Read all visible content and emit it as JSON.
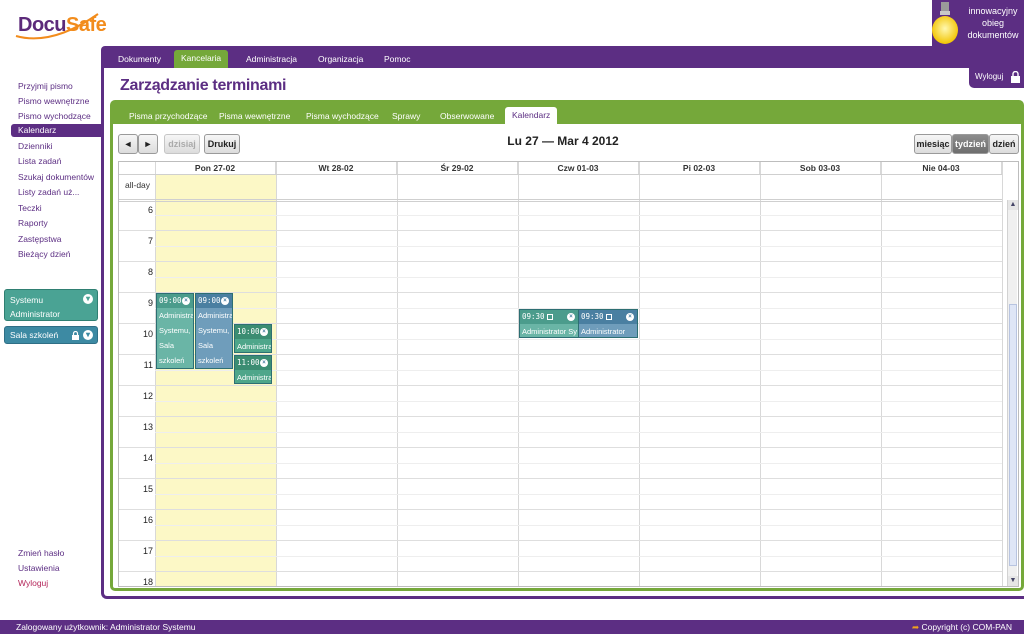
{
  "brand": {
    "logo_part1": "Docu",
    "logo_part2": "Safe",
    "tagline_lines": [
      "innowacyjny",
      "obieg",
      "dokumentów"
    ]
  },
  "top_tabs": [
    {
      "label": "Dokumenty",
      "active": false
    },
    {
      "label": "Kancelaria",
      "active": true
    },
    {
      "label": "Administracja",
      "active": false
    },
    {
      "label": "Organizacja",
      "active": false
    },
    {
      "label": "Pomoc",
      "active": false
    }
  ],
  "sidebar": {
    "items": [
      {
        "label": "Przyjmij pismo",
        "active": false
      },
      {
        "label": "Pismo wewnętrzne",
        "active": false
      },
      {
        "label": "Pismo wychodzące",
        "active": false
      },
      {
        "label": "Kalendarz",
        "active": true
      },
      {
        "label": "Dzienniki",
        "active": false
      },
      {
        "label": "Lista zadań",
        "active": false
      },
      {
        "label": "Szukaj dokumentów",
        "active": false
      },
      {
        "label": "Listy zadań uż...",
        "active": false
      },
      {
        "label": "Teczki",
        "active": false
      },
      {
        "label": "Raporty",
        "active": false
      },
      {
        "label": "Zastępstwa",
        "active": false
      },
      {
        "label": "Bieżący dzień",
        "active": false
      }
    ],
    "user_box": {
      "line1": "Systemu",
      "line2": "Administrator"
    },
    "room_box": {
      "label": "Sala szkoleń"
    },
    "bottom_links": [
      {
        "label": "Zmień hasło",
        "color": "#5c2e83"
      },
      {
        "label": "Ustawienia",
        "color": "#5c2e83"
      },
      {
        "label": "Wyloguj",
        "color": "#b4265a"
      }
    ]
  },
  "page": {
    "title": "Zarządzanie terminami",
    "logout_label": "Wyloguj"
  },
  "sub_tabs": [
    {
      "label": "Pisma przychodzące",
      "active": false
    },
    {
      "label": "Pisma wewnętrzne",
      "active": false
    },
    {
      "label": "Pisma wychodzące",
      "active": false
    },
    {
      "label": "Sprawy",
      "active": false
    },
    {
      "label": "Obserwowane",
      "active": false
    },
    {
      "label": "Kalendarz",
      "active": true
    }
  ],
  "calendar": {
    "prev_label": "◄",
    "next_label": "►",
    "today_label": "dzisiaj",
    "print_label": "Drukuj",
    "range_title": "Lu 27 — Mar 4 2012",
    "views": [
      {
        "label": "miesiąc",
        "active": false
      },
      {
        "label": "tydzień",
        "active": true
      },
      {
        "label": "dzień",
        "active": false
      }
    ],
    "allday_label": "all-day",
    "days": [
      "Pon 27-02",
      "Wt 28-02",
      "Śr 29-02",
      "Czw 01-03",
      "Pi 02-03",
      "Sob 03-03",
      "Nie 04-03"
    ],
    "hours": [
      "6",
      "7",
      "8",
      "9",
      "10",
      "11",
      "12",
      "13",
      "14",
      "15",
      "16",
      "17",
      "18"
    ],
    "events": [
      {
        "day": 0,
        "start": 9.0,
        "end": 11.5,
        "lane": 0,
        "lanes": 3,
        "time": "09:00",
        "lines": [
          "Administra",
          "Systemu,",
          "Sala",
          "szkoleń"
        ],
        "style": "teal",
        "icon": "close"
      },
      {
        "day": 0,
        "start": 9.0,
        "end": 11.5,
        "lane": 1,
        "lanes": 3,
        "time": "09:00",
        "lines": [
          "Administra",
          "Systemu,",
          "Sala",
          "szkoleń"
        ],
        "style": "blue",
        "icon": "close"
      },
      {
        "day": 0,
        "start": 10.0,
        "end": 11.0,
        "lane": 2,
        "lanes": 3,
        "time": "10:00",
        "lines": [
          "Administra"
        ],
        "style": "green",
        "icon": "close"
      },
      {
        "day": 0,
        "start": 11.0,
        "end": 12.0,
        "lane": 2,
        "lanes": 3,
        "time": "11:00",
        "lines": [
          "Administra"
        ],
        "style": "green",
        "icon": "close"
      },
      {
        "day": 3,
        "start": 9.5,
        "end": 10.5,
        "lane": 0,
        "lanes": 2,
        "time": "09:30",
        "lines": [
          "Administrator Sy"
        ],
        "style": "teal",
        "icon": "close",
        "copy": true
      },
      {
        "day": 3,
        "start": 9.5,
        "end": 10.5,
        "lane": 1,
        "lanes": 2,
        "time": "09:30",
        "lines": [
          "Administrator Sys"
        ],
        "style": "blue",
        "icon": "close",
        "copy": true
      }
    ]
  },
  "footer": {
    "left": "Zalogowany użytkownik: Administrator Systemu",
    "right": "Copyright (c) COM-PAN"
  }
}
